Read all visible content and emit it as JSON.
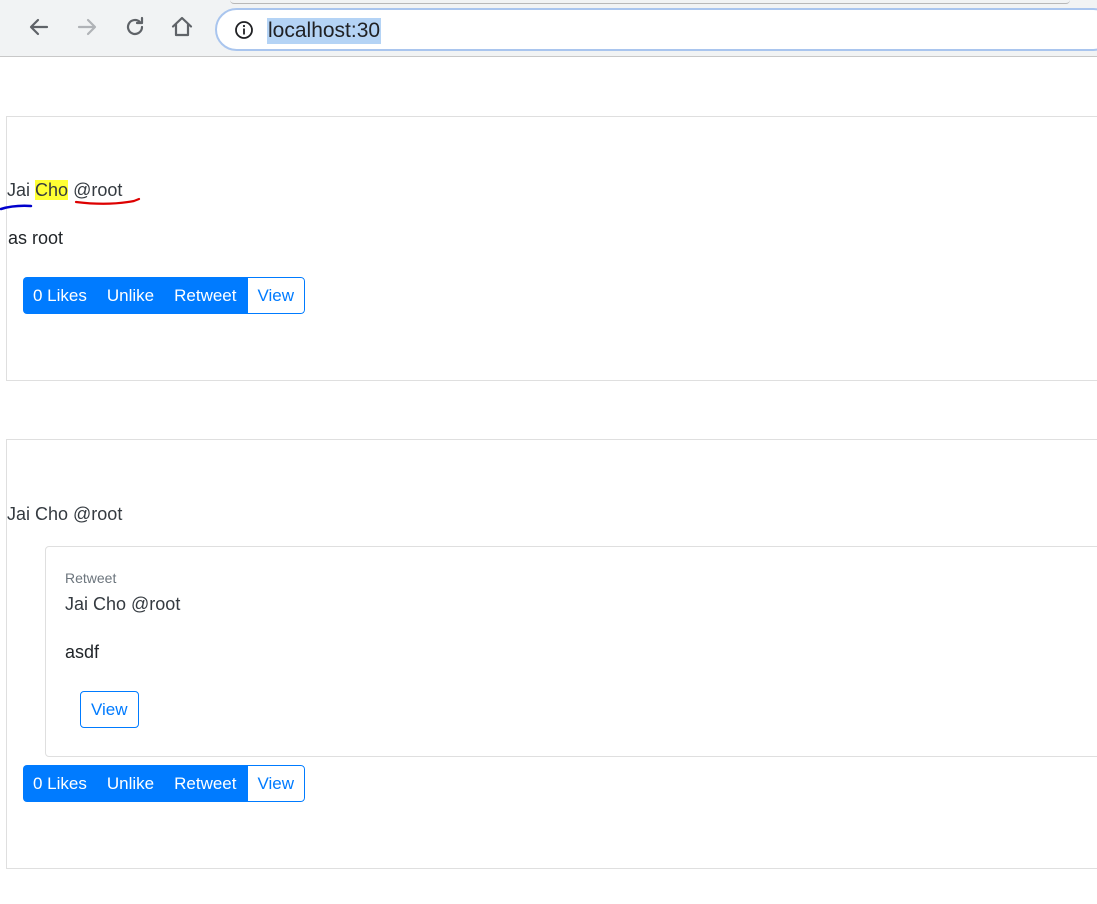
{
  "browser": {
    "back_icon": "arrow-left-icon",
    "forward_icon": "arrow-right-icon",
    "reload_icon": "reload-icon",
    "home_icon": "home-icon",
    "info_icon": "info-icon",
    "url": "localhost:30"
  },
  "colors": {
    "primary": "#007bff",
    "highlight": "#ffff33",
    "annotation_blue": "#0000cc",
    "annotation_red": "#dd0000"
  },
  "tweets": [
    {
      "author_first": "Jai",
      "author_last": "Cho",
      "handle": "@root",
      "body": "as root",
      "buttons": {
        "likes": "0 Likes",
        "unlike": "Unlike",
        "retweet": "Retweet",
        "view": "View"
      }
    },
    {
      "author": "Jai Cho @root",
      "retweet": {
        "label": "Retweet",
        "author": "Jai Cho @root",
        "body": "asdf",
        "view": "View"
      },
      "buttons": {
        "likes": "0 Likes",
        "unlike": "Unlike",
        "retweet": "Retweet",
        "view": "View"
      }
    }
  ]
}
